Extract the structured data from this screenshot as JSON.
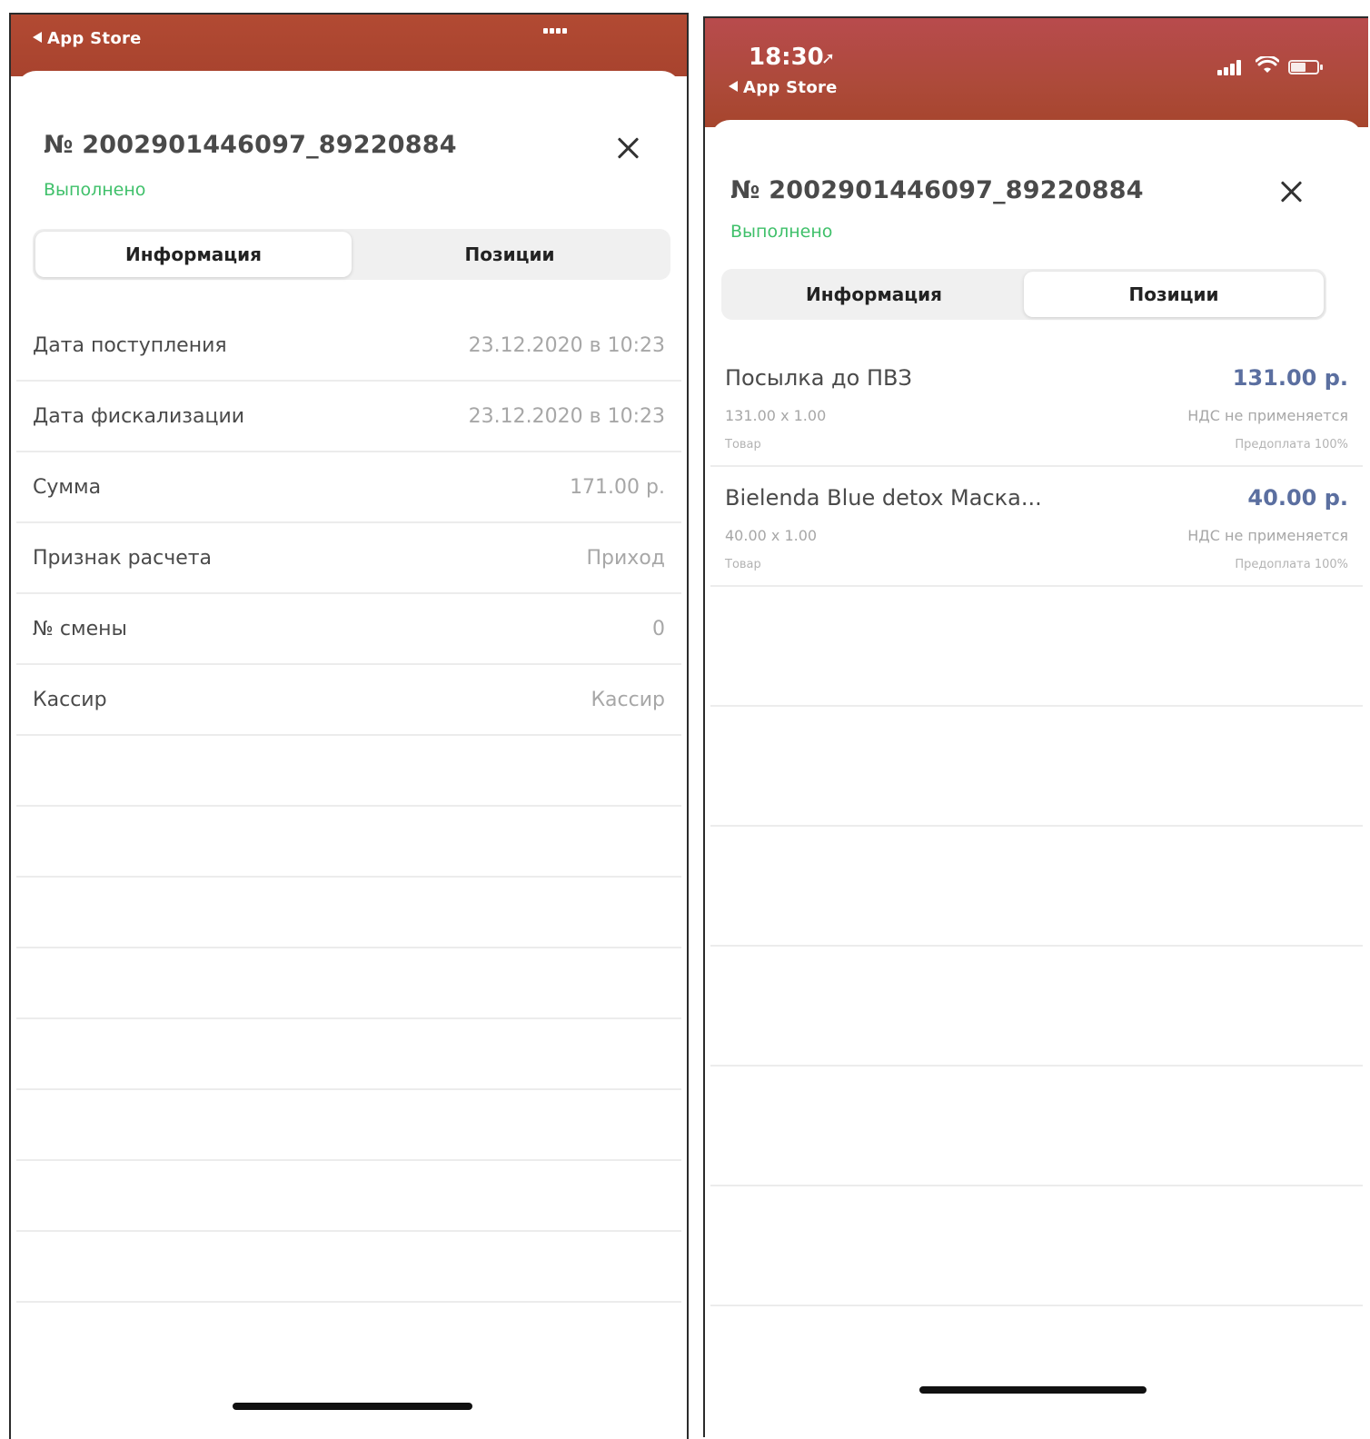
{
  "left": {
    "status_bar": {
      "back_label": "App Store"
    },
    "title": "№ 2002901446097_89220884",
    "status": "Выполнено",
    "tabs": [
      {
        "label": "Информация",
        "active": true
      },
      {
        "label": "Позиции",
        "active": false
      }
    ],
    "info_rows": [
      {
        "label": "Дата поступления",
        "value": "23.12.2020 в 10:23"
      },
      {
        "label": "Дата фискализации",
        "value": "23.12.2020 в 10:23"
      },
      {
        "label": "Сумма",
        "value": "171.00 р."
      },
      {
        "label": "Признак расчета",
        "value": "Приход"
      },
      {
        "label": "№ смены",
        "value": "0"
      },
      {
        "label": "Кассир",
        "value": "Кассир"
      }
    ]
  },
  "right": {
    "status_bar": {
      "time": "18:30",
      "back_label": "App Store"
    },
    "title": "№ 2002901446097_89220884",
    "status": "Выполнено",
    "tabs": [
      {
        "label": "Информация",
        "active": false
      },
      {
        "label": "Позиции",
        "active": true
      }
    ],
    "positions": [
      {
        "name": "Посылка до ПВЗ",
        "price": "131.00 р.",
        "calc": "131.00 x 1.00",
        "vat": "НДС не применяется",
        "type": "Товар",
        "payment": "Предоплата 100%"
      },
      {
        "name": "Bielenda Blue detox Маска...",
        "price": "40.00 р.",
        "calc": "40.00 x 1.00",
        "vat": "НДС не применяется",
        "type": "Товар",
        "payment": "Предоплата 100%"
      }
    ]
  },
  "colors": {
    "header": "#a8432e",
    "status_green": "#3fc06a",
    "price_blue": "#5b6fa0"
  }
}
